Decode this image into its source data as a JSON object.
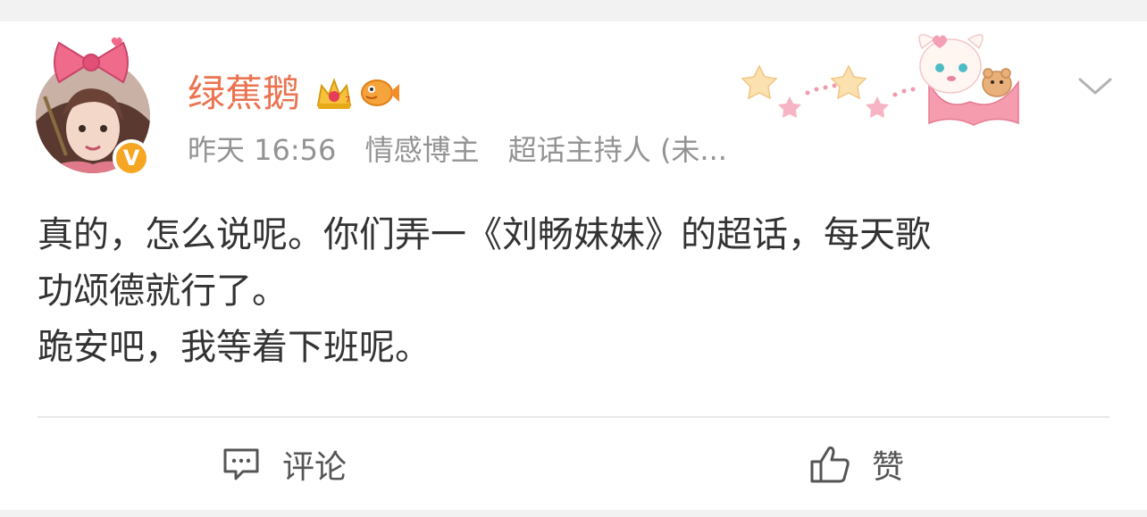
{
  "post": {
    "author": {
      "name": "绿蕉鹅",
      "verified_badge": "V",
      "badges": [
        "crown-icon",
        "fish-icon"
      ]
    },
    "meta": {
      "time": "昨天 16:56",
      "tag1": "情感博主",
      "tag2": "超话主持人 (未..."
    },
    "content": {
      "line1": "真的，怎么说呢。你们弄一《刘畅妹妹》的超话，每天歌",
      "line2": "功颂德就行了。",
      "line3": "跪安吧，我等着下班呢。"
    }
  },
  "actions": {
    "comment_label": "评论",
    "like_label": "赞"
  },
  "colors": {
    "username": "#eb7350",
    "meta": "#939393",
    "text": "#333333",
    "verified": "#f5a623"
  }
}
